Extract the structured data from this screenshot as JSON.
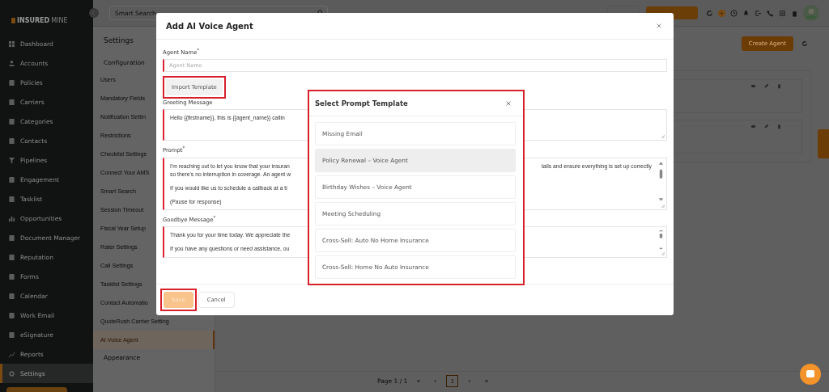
{
  "sidebar": {
    "logo_a": "INSURED",
    "logo_b": "MINE",
    "items": [
      {
        "label": "Dashboard",
        "selected": false
      },
      {
        "label": "Accounts",
        "selected": false
      },
      {
        "label": "Policies",
        "selected": false
      },
      {
        "label": "Carriers",
        "selected": false
      },
      {
        "label": "Categories",
        "selected": false
      },
      {
        "label": "Contacts",
        "selected": false
      },
      {
        "label": "Pipelines",
        "selected": false
      },
      {
        "label": "Engagement",
        "selected": false
      },
      {
        "label": "Tasklist",
        "selected": false
      },
      {
        "label": "Opportunities",
        "selected": false
      },
      {
        "label": "Document Manager",
        "selected": false
      },
      {
        "label": "Reputation",
        "selected": false
      },
      {
        "label": "Forms",
        "selected": false
      },
      {
        "label": "Calendar",
        "selected": false
      },
      {
        "label": "Work Email",
        "selected": false
      },
      {
        "label": "eSignature",
        "selected": false
      },
      {
        "label": "Reports",
        "selected": false
      },
      {
        "label": "Settings",
        "selected": true
      }
    ]
  },
  "top_bar": {
    "search": {
      "placeholder": "Smart Search"
    }
  },
  "settings_panel": {
    "title": "Settings",
    "sections": [
      {
        "label": "Configuration",
        "items": [
          {
            "label": "Users",
            "selected": false
          },
          {
            "label": "Mandatory Fields",
            "selected": false
          },
          {
            "label": "Notification Settin",
            "selected": false
          },
          {
            "label": "Restrictions",
            "selected": false
          },
          {
            "label": "Checklist Settings",
            "selected": false
          },
          {
            "label": "Connect Your AMS",
            "selected": false
          },
          {
            "label": "Smart Search",
            "selected": false
          },
          {
            "label": "Session Timeout",
            "selected": false
          },
          {
            "label": "Fiscal Year Setup",
            "selected": false
          },
          {
            "label": "Rater Settings",
            "selected": false
          },
          {
            "label": "Call Settings",
            "selected": false
          },
          {
            "label": "Tasklist Settings",
            "selected": false
          },
          {
            "label": "Contact Automatio",
            "selected": false
          },
          {
            "label": "QuoteRush Carrier Setting",
            "selected": false
          },
          {
            "label": "AI Voice Agent",
            "selected": true
          }
        ]
      },
      {
        "label": "Appearance"
      }
    ]
  },
  "page": {
    "create_button": "Create Agent",
    "pagination": {
      "label": "Page 1 / 1",
      "buttons": [
        {
          "text": "«",
          "selected": false
        },
        {
          "text": "‹",
          "selected": false
        },
        {
          "text": "1",
          "selected": true
        },
        {
          "text": "›",
          "selected": false
        },
        {
          "text": "»",
          "selected": false
        }
      ]
    }
  },
  "modal": {
    "title": "Add AI Voice Agent",
    "agent_name": {
      "label": "Agent Name$^{*}$",
      "placeholder": "Agent Name"
    },
    "import_button": {
      "label": "Import Template",
      "highlighted": true
    },
    "text_areas": [
      {
        "label": "Greeting Message",
        "scrollable": false,
        "paragraphs": [
          [
            {
              "left": "Hello {{firstname}}, this is {{agent_name}} callin"
            }
          ]
        ]
      },
      {
        "label": "Prompt$^{*}$",
        "scrollable": true,
        "paragraphs": [
          [
            {
              "left": "I'm reaching out to let you know that your insuran",
              "right": "tails and ensure everything is set up correctly"
            },
            {
              "left": "so there's no interruption in coverage. An agent w"
            }
          ],
          [
            {
              "left": "If you would like us to schedule a callback at a ti"
            }
          ],
          [
            {
              "left": "(Pause for response)"
            }
          ]
        ]
      },
      {
        "label": "Goodbye Message$^{*}$",
        "scrollable": true,
        "paragraphs": [
          [
            {
              "left": "Thank you for your time today. We appreciate the"
            }
          ],
          [
            {
              "left": "If you have any questions or need assistance, ou"
            }
          ]
        ]
      }
    ],
    "save": {
      "label": "Save",
      "disabled": true,
      "highlighted": true
    },
    "cancel": {
      "label": "Cancel"
    }
  },
  "template_dialog": {
    "title": "Select Prompt Template",
    "highlighted": true,
    "items": [
      {
        "label": "Missing Email",
        "selected": false
      },
      {
        "label": "Policy Renewal – Voice Agent",
        "selected": true
      },
      {
        "label": "Birthday Wishes – Voice Agent",
        "selected": false
      },
      {
        "label": "Meeting Scheduling",
        "selected": false
      },
      {
        "label": "Cross-Sell: Auto No Home Insurance",
        "selected": false
      },
      {
        "label": "Cross-Sell: Home No Auto Insurance",
        "selected": false
      }
    ]
  }
}
